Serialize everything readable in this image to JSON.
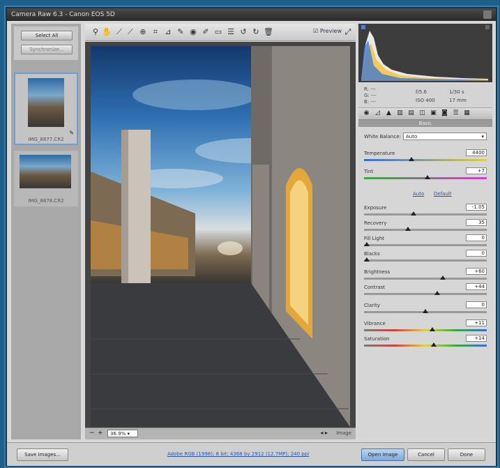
{
  "window": {
    "title": "Camera Raw 6.3 - Canon EOS 5D"
  },
  "filmstrip": {
    "select_all": "Select All",
    "synchronize": "Synchronize...",
    "thumbs": [
      {
        "label": "IMG_8877.CR2",
        "selected": true
      },
      {
        "label": "IMG_8878.CR2",
        "selected": false
      }
    ]
  },
  "toolbar": {
    "tools": [
      "zoom-icon",
      "hand-icon",
      "white-balance-icon",
      "color-sampler-icon",
      "target-adjust-icon",
      "crop-icon",
      "straighten-icon",
      "spot-removal-icon",
      "red-eye-icon",
      "adjustment-brush-icon",
      "graduated-filter-icon",
      "preferences-icon",
      "rotate-ccw-icon",
      "rotate-cw-icon",
      "trash-icon"
    ],
    "preview_label": "Preview"
  },
  "canvas": {
    "zoom_value": "36.9%",
    "bottom_right_label": "Image"
  },
  "readout": {
    "r_label": "R:",
    "g_label": "G:",
    "b_label": "B:",
    "r": "---",
    "g": "---",
    "b": "---",
    "f_stop": "f/5.6",
    "shutter": "1/30 s",
    "iso": "ISO 400",
    "focal": "17 mm"
  },
  "panel": {
    "header": "Basic",
    "white_balance_label": "White Balance:",
    "white_balance_value": "Auto",
    "temperature": {
      "label": "Temperature",
      "value": "4400",
      "level": 0.38
    },
    "tint": {
      "label": "Tint",
      "value": "+7",
      "level": 0.52
    },
    "auto_link": "Auto",
    "default_link": "Default",
    "sliders": [
      {
        "label": "Exposure",
        "value": "-1.05",
        "level": 0.4
      },
      {
        "label": "Recovery",
        "value": "35",
        "level": 0.35
      },
      {
        "label": "Fill Light",
        "value": "0",
        "level": 0.0
      },
      {
        "label": "Blacks",
        "value": "0",
        "level": 0.0
      },
      {
        "label": "Brightness",
        "value": "+60",
        "level": 0.65
      },
      {
        "label": "Contrast",
        "value": "+44",
        "level": 0.6
      },
      {
        "label": "Clarity",
        "value": "0",
        "level": 0.5
      },
      {
        "label": "Vibrance",
        "value": "+11",
        "level": 0.56
      },
      {
        "label": "Saturation",
        "value": "+14",
        "level": 0.57
      }
    ]
  },
  "bottom": {
    "save_image": "Save Images...",
    "workflow_link": "Adobe RGB (1998); 8 bit; 4368 by 2912 (12.7MP); 240 ppi",
    "open_image": "Open Image",
    "cancel": "Cancel",
    "done": "Done"
  },
  "colors": {
    "accent": "#1f5f8c",
    "panel": "#d6d6d6",
    "selection": "#6b9fd6"
  }
}
